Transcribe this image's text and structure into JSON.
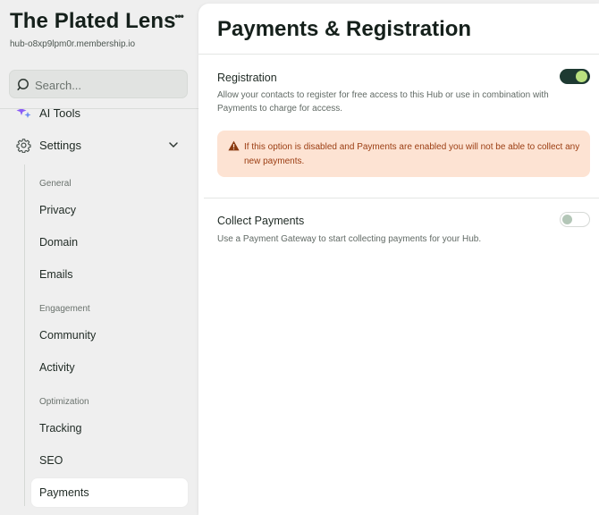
{
  "sidebar": {
    "brand": "The Plated Lens",
    "hub_url": "hub-o8xp9lpm0r.membership.io",
    "search_placeholder": "Search...",
    "ai_tools_label": "AI Tools",
    "settings_label": "Settings",
    "sections": [
      {
        "label": "General",
        "items": [
          "Privacy",
          "Domain",
          "Emails"
        ]
      },
      {
        "label": "Engagement",
        "items": [
          "Community",
          "Activity"
        ]
      },
      {
        "label": "Optimization",
        "items": [
          "Tracking",
          "SEO",
          "Payments"
        ]
      }
    ],
    "active_item": "Payments"
  },
  "main": {
    "title": "Payments & Registration",
    "registration": {
      "title": "Registration",
      "description": "Allow your contacts to register for free access to this Hub or use in combination with Payments to charge for access.",
      "enabled": true
    },
    "warning": "If this option is disabled and Payments are enabled you will not be able to collect any new payments.",
    "collect_payments": {
      "title": "Collect Payments",
      "description": "Use a Payment Gateway to start collecting payments for your Hub.",
      "enabled": false
    }
  },
  "colors": {
    "toggle_on_track": "#1e3a32",
    "toggle_on_knob": "#b9e07f",
    "warning_bg": "#fde3d3",
    "warning_text": "#9b3d12"
  }
}
